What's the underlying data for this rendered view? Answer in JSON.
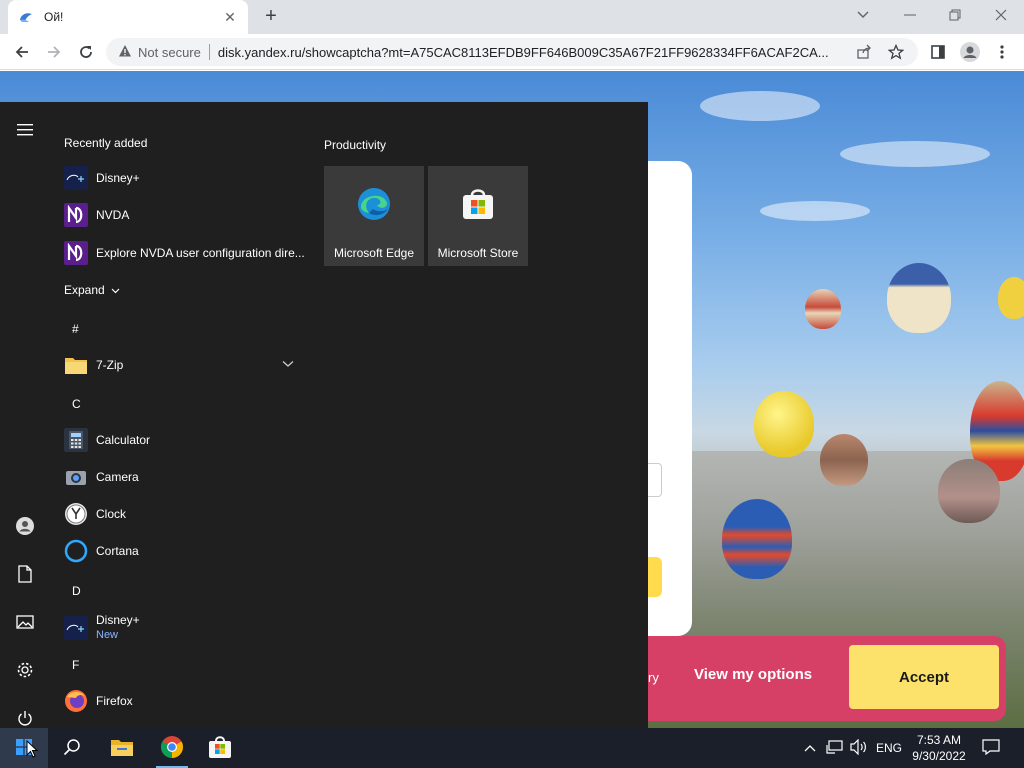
{
  "browser": {
    "tab_title": "Ой!",
    "url": "disk.yandex.ru/showcaptcha?mt=A75CAC8113EFDB9FF646B009C35A67F21FF9628334FF6ACAF2CA...",
    "security_label": "Not secure"
  },
  "page": {
    "cookie_text_fragment_1": "",
    "cookie_text_fragment_2": "ry",
    "view_options_label": "View my options",
    "accept_label": "Accept",
    "colors": {
      "cookie_bar": "#d63f66",
      "accept_button": "#fce26a"
    }
  },
  "start_menu": {
    "recently_added_title": "Recently added",
    "recent": [
      {
        "label": "Disney+",
        "icon": "disney-plus-icon"
      },
      {
        "label": "NVDA",
        "icon": "nvda-icon"
      },
      {
        "label": "Explore NVDA user configuration dire...",
        "icon": "nvda-icon"
      }
    ],
    "expand_label": "Expand",
    "letters": {
      "hash": "#",
      "c": "C",
      "d": "D",
      "f": "F"
    },
    "apps": {
      "sevenzip": "7-Zip",
      "calculator": "Calculator",
      "camera": "Camera",
      "clock": "Clock",
      "cortana": "Cortana",
      "disney": "Disney+",
      "disney_sub": "New",
      "firefox": "Firefox"
    },
    "group_title": "Productivity",
    "tiles": [
      {
        "label": "Microsoft Edge",
        "icon": "edge-icon"
      },
      {
        "label": "Microsoft Store",
        "icon": "store-icon"
      }
    ]
  },
  "taskbar": {
    "language": "ENG",
    "time": "7:53 AM",
    "date": "9/30/2022"
  }
}
